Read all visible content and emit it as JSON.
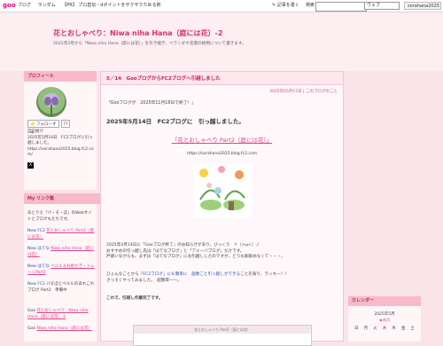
{
  "topbar": {
    "logo": "goo",
    "nav": [
      "ブログ",
      "ランダム",
      "【PR】 プロ直伝・dポイントをザクザクためる術"
    ],
    "compose": "✎ 記事を書く",
    "search_label": "検索",
    "search_placeholder": "",
    "search_scope": "ウェブ",
    "user": "sorahana2025"
  },
  "header": {
    "title": "花とおしゃべり：Niwa niha Hana（庭には花）-2",
    "description": "2022年4月から「Niwa niha Hana（庭には花）」を引き継ぎ、ベランダや花壇の植物について書きます。"
  },
  "profile": {
    "heading": "プロフィール",
    "follow_label": "フォローする",
    "follow_count": "77",
    "intro_label": "自己紹介",
    "intro_lines": [
      "2025年5月14日　FC2ブログに引っ越しました。",
      "https://sorahana2025.blog.fc2.com/"
    ]
  },
  "links": {
    "heading": "My リンク集",
    "items": [
      {
        "prefix": "",
        "text": "あとりえ「パ・そ・ぼ」のWebサイトとブログもたちです。",
        "link": ""
      },
      {
        "prefix": "New FC2",
        "text": "",
        "link": "花とおしゃべり Part2（庭には花）"
      },
      {
        "prefix": "New はてな",
        "text": "",
        "link": "Niwa niha Hana（庭には花）"
      },
      {
        "prefix": "New はてな",
        "text": "",
        "link": "ベルル＆お絵かき・トレーニPart2"
      },
      {
        "prefix": "New FC2",
        "text": "パそぼとペルルのあれこれブログ Part2　準備中",
        "link": ""
      },
      {
        "prefix": "Goo",
        "text": "",
        "link": "花とおしゃべり：Niwa niha Hana（庭には花）-2"
      },
      {
        "prefix": "Goo",
        "text": "",
        "link": "Niwa niha Hana（庭には花）"
      }
    ]
  },
  "post": {
    "title": "5／14　GooブログからFC2ブログへ引越しました",
    "date_line": "2025年05月15日 | このブログのこと",
    "notice": "「Gooブログが　2025年11月18日で終了！」",
    "date_heading": "2025年5月14日　FC2ブログに　引っ越しました。",
    "new_blog_link": "「花とおしゃべり Part2（庭には花）」",
    "new_blog_url": "https://sorahana2025.blog.fc2.com",
    "paragraph1": [
      "2025年4月14日に「Gooブログ終了」のお知らせがあり、びっくり　!!（>ω<）ノ",
      "おすすめの引っ越し先は「はてなブログ」と「アメーバブログ」だけです。",
      "戸惑いながらも、まずは「はてなブログ」にお引越ししたのですが、どうも馴染めなくて・・・。"
    ],
    "paragraph2_a": "ひょんなことから「",
    "paragraph2_hl": "FC2ブログ」にも簡単に　画像ごと引っ越しができる",
    "paragraph2_b": "ことを知り、ラッキー！！",
    "paragraph2_line2": "さっそくやってみました。　超簡単〜〜。",
    "paragraph3": "これで、引越し作業完了です。",
    "embedded_header": "花とおしゃべり Part2（庭には花）"
  },
  "calendar": {
    "heading": "カレンダー",
    "month": "2025年5月",
    "nav": "◀ 前月",
    "weekdays": [
      "日",
      "月",
      "火",
      "水",
      "木",
      "金",
      "土"
    ],
    "row1": [
      "",
      "",
      "",
      "",
      "1",
      "2",
      "3"
    ],
    "today": "1"
  },
  "colors": {
    "accent": "#e0458a",
    "title": "#d9316f",
    "background": "#fbe3ea"
  }
}
